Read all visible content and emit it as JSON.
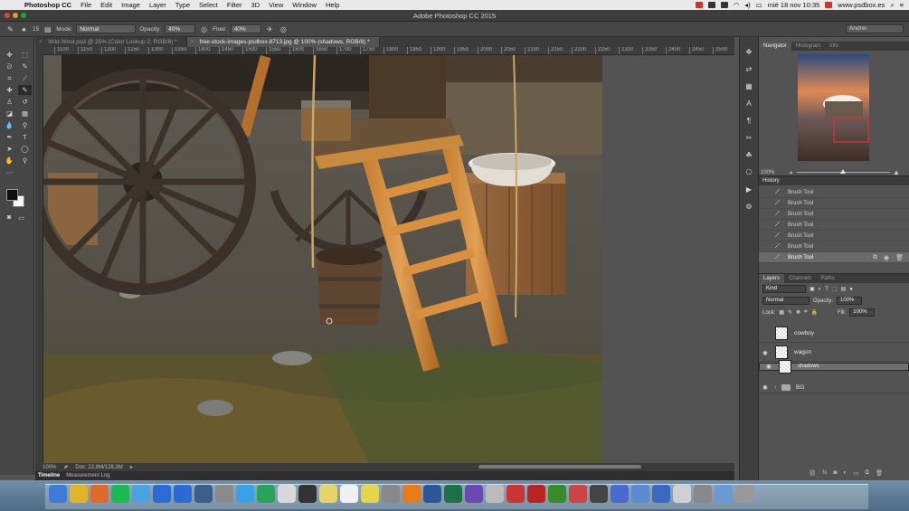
{
  "menubar": {
    "items": [
      "Photoshop CC",
      "File",
      "Edit",
      "Image",
      "Layer",
      "Type",
      "Select",
      "Filter",
      "3D",
      "View",
      "Window",
      "Help"
    ],
    "clock": "mié 18 nov 10:35",
    "site": "www.psdbox.es"
  },
  "window": {
    "title": "Adobe Photoshop CC 2015"
  },
  "options": {
    "brush_size": "15",
    "mode_label": "Mode:",
    "mode_value": "Normal",
    "opacity_label": "Opacity:",
    "opacity_value": "40%",
    "flow_label": "Flow:",
    "flow_value": "40%",
    "workspace": "Andrei"
  },
  "doc_tabs": [
    {
      "label": "Wild-West.psd @ 25% (Color Lookup 2, RGB/8) *"
    },
    {
      "label": "free-stock-images-psdbox-8713.jpg @ 100% (shadows, RGB/8) *"
    }
  ],
  "ruler": {
    "ticks": [
      "1100",
      "1150",
      "1200",
      "1250",
      "1300",
      "1350",
      "1400",
      "1450",
      "1500",
      "1550",
      "1600",
      "1650",
      "1700",
      "1750",
      "1800",
      "1850",
      "1900",
      "1950",
      "2000",
      "2050",
      "2100",
      "2150",
      "2200",
      "2250",
      "2300",
      "2350",
      "2400",
      "2450",
      "2500",
      "255"
    ]
  },
  "status": {
    "zoom": "100%",
    "doc": "Doc: 22,8M/128,3M"
  },
  "timeline": {
    "tabs": [
      "Timeline",
      "Measurement Log"
    ]
  },
  "navigator": {
    "tabs": [
      "Navigator",
      "Histogram",
      "Info"
    ],
    "zoom": "100%"
  },
  "history": {
    "title": "History",
    "items": [
      "Brush Tool",
      "Brush Tool",
      "Brush Tool",
      "Brush Tool",
      "Brush Tool",
      "Brush Tool",
      "Brush Tool"
    ]
  },
  "layers": {
    "tabs": [
      "Layers",
      "Channels",
      "Paths"
    ],
    "kind": "Kind",
    "blend": "Normal",
    "opacity_label": "Opacity:",
    "opacity_value": "100%",
    "lock_label": "Lock:",
    "fill_label": "Fill:",
    "fill_value": "100%",
    "items": [
      {
        "name": "cowboy",
        "visible": false
      },
      {
        "name": "wagon",
        "visible": true
      },
      {
        "name": "shadows",
        "visible": true
      },
      {
        "name": "BG",
        "visible": true
      }
    ]
  },
  "dock_apps": [
    "Finder",
    "Chrome",
    "Firefox",
    "Spotify",
    "Tweetbot",
    "Photoshop",
    "Photoshop",
    "Lightroom",
    "Preview",
    "Safari",
    "Camtasia",
    "Launchpad",
    "Activity",
    "Notes",
    "Calendar",
    "Stickies",
    "Prefs",
    "VLC",
    "Word",
    "Excel",
    "iMovie",
    "Calculator",
    "Mosaic",
    "FileZilla",
    "Dreamweaver",
    "Transmit",
    "Papers",
    "Keynote",
    "Network",
    "Bluetooth",
    "Files",
    "Help",
    "Downloads",
    "Trash"
  ]
}
